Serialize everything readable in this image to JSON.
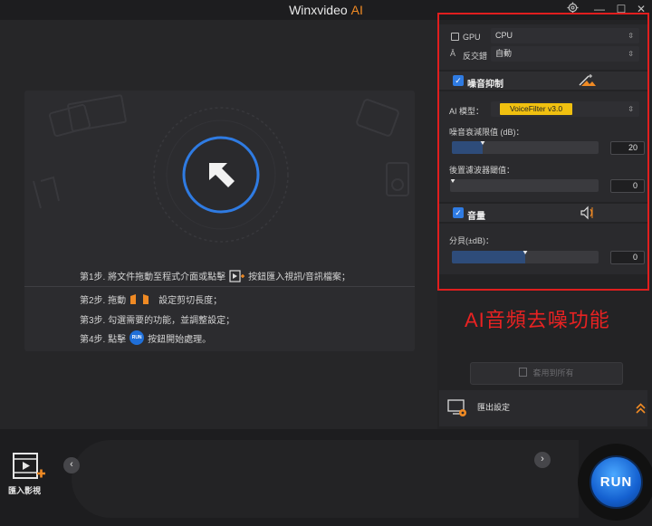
{
  "window": {
    "title": "Winxvideo",
    "title_suffix": "AI",
    "controls": {
      "settings_icon": "gear-icon",
      "minimize": "—",
      "maximize": "☐",
      "close": "✕"
    }
  },
  "drop_area": {
    "step1_pre": "第1步. 將文件拖動至程式介面或點擊",
    "step1_post": "按鈕匯入視訊/音訊檔案；",
    "step2_pre": "第2步. 拖動",
    "step2_post": "設定剪切長度；",
    "step3": "第3步. 勾選需要的功能，並調整設定；",
    "step4_pre": "第4步. 點擊",
    "step4_post": "按鈕開始處理。",
    "run_mini": "RUN"
  },
  "panel": {
    "gpu_label": "GPU",
    "gpu_value": "CPU",
    "deinterlace_label": "反交錯",
    "deinterlace_value": "自動",
    "noise": {
      "enabled": true,
      "title": "噪音抑制",
      "model_label": "AI 模型：",
      "model_value": "VoiceFilter v3.0",
      "threshold_label": "噪音衰減限值 (dB)：",
      "threshold_value": "20",
      "threshold_fraction": 0.21,
      "post_label": "後置濾波器閾值：",
      "post_value": "0",
      "post_fraction": 0.0
    },
    "volume": {
      "enabled": true,
      "title": "音量",
      "db_label": "分貝(±dB)：",
      "db_value": "0",
      "db_fraction": 0.5
    },
    "apply_all": "套用到所有",
    "export_settings": "匯出設定"
  },
  "annotation": "AI音頻去噪功能",
  "bottom": {
    "import_label": "匯入影視",
    "prev_arrow": "‹",
    "next_arrow": "›",
    "run_label": "RUN"
  },
  "colors": {
    "accent": "#2f7be2",
    "brand_orange": "#f08a24",
    "annotation_red": "#e01e1e",
    "model_tag": "#f0c010"
  }
}
